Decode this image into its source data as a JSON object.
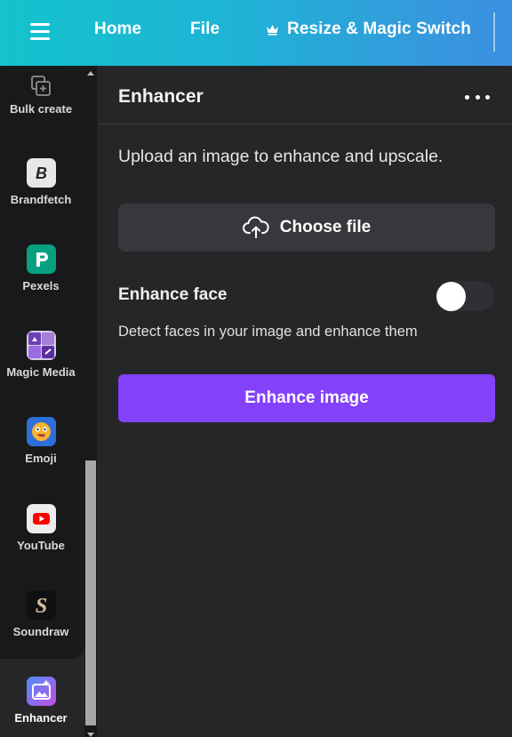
{
  "header": {
    "menu_icon": "hamburger-menu-icon",
    "nav": {
      "home": "Home",
      "file": "File",
      "resize": "Resize & Magic Switch"
    },
    "gradient_colors": [
      "#14c3cd",
      "#3d8fe0"
    ]
  },
  "sidebar": {
    "items": [
      {
        "label": "Bulk create",
        "icon": "bulk-create-icon"
      },
      {
        "label": "Brandfetch",
        "icon": "brandfetch-icon"
      },
      {
        "label": "Pexels",
        "icon": "pexels-icon"
      },
      {
        "label": "Magic Media",
        "icon": "magic-media-icon"
      },
      {
        "label": "Emoji",
        "icon": "emoji-icon"
      },
      {
        "label": "YouTube",
        "icon": "youtube-icon"
      },
      {
        "label": "Soundraw",
        "icon": "soundraw-icon"
      },
      {
        "label": "Enhancer",
        "icon": "enhancer-icon",
        "active": true
      }
    ]
  },
  "panel": {
    "title": "Enhancer",
    "more_icon": "more-options-icon",
    "description": "Upload an image to enhance and upscale.",
    "choose_file_label": "Choose file",
    "enhance_face": {
      "label": "Enhance face",
      "enabled": false,
      "description": "Detect faces in your image and enhance them"
    },
    "enhance_button_label": "Enhance image",
    "accent_color": "#8342fa"
  }
}
